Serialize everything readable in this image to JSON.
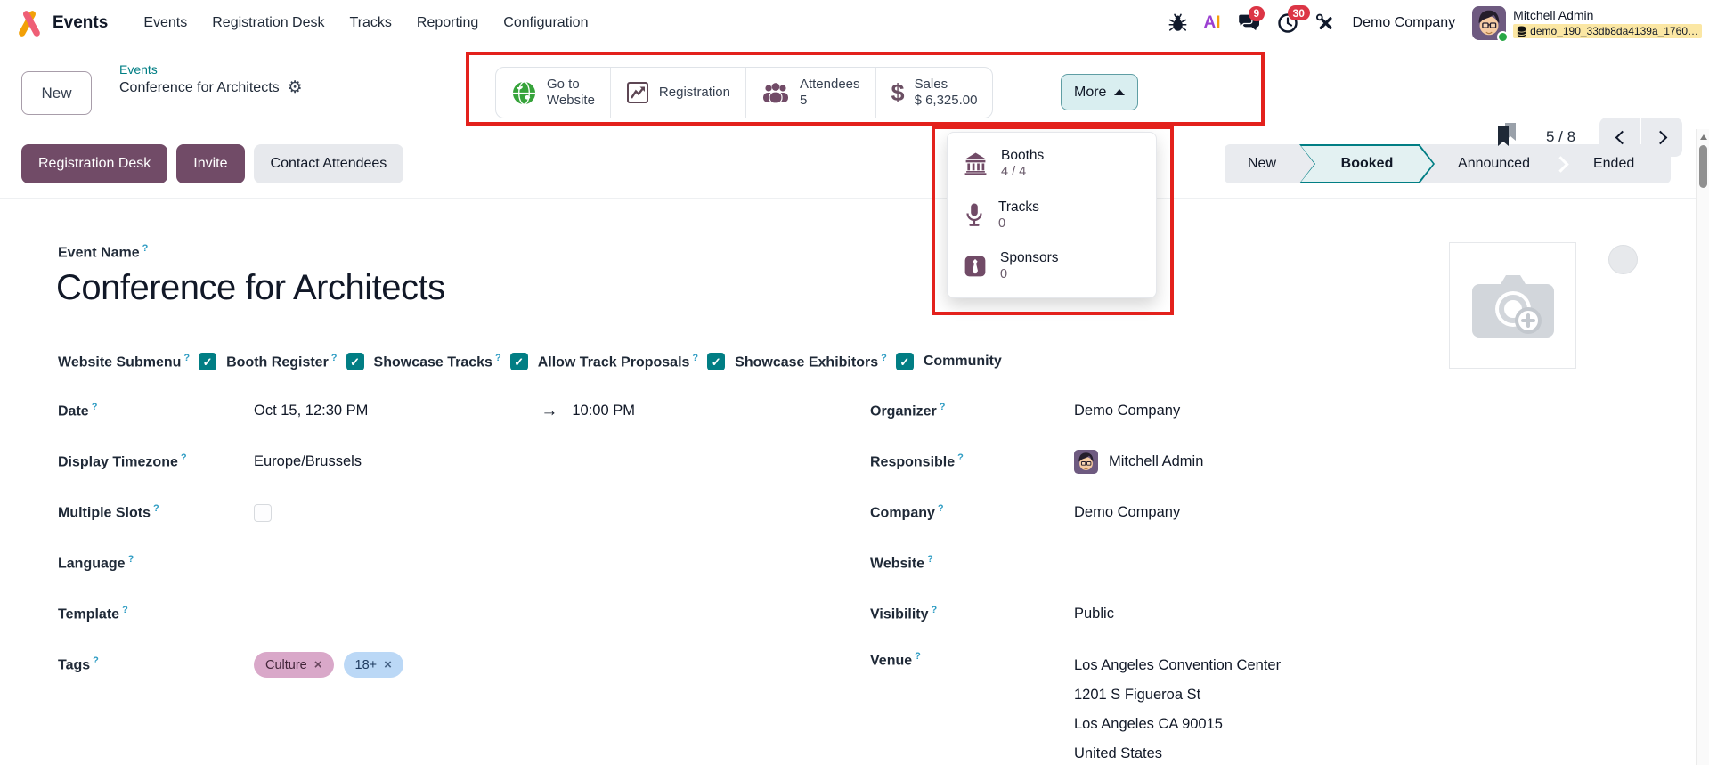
{
  "colors": {
    "primary": "#714B67",
    "accent_teal": "#017E84",
    "annotation_red": "#E3211C",
    "badge_red": "#DC3545",
    "tag_culture_bg": "#D9A8C9",
    "tag_18plus_bg": "#BBD8F6"
  },
  "nav": {
    "app_name": "Events",
    "menus": [
      "Events",
      "Registration Desk",
      "Tracks",
      "Reporting",
      "Configuration"
    ],
    "systray": {
      "messages_badge": "9",
      "activities_badge": "30",
      "ai_a": "A",
      "ai_i": "I",
      "company": "Demo Company",
      "user_name": "Mitchell Admin",
      "database": "demo_190_33db8da4139a_1760…"
    }
  },
  "control_panel": {
    "new_button": "New",
    "breadcrumb_parent": "Events",
    "record_title": "Conference for Architects",
    "pager": "5 / 8"
  },
  "smart_buttons": {
    "go_to_website": {
      "line1": "Go to",
      "line2": "Website",
      "icon": "globe-icon"
    },
    "registration": {
      "line1": "Registration",
      "icon": "chart-icon"
    },
    "attendees": {
      "line1": "Attendees",
      "line2": "5",
      "icon": "users-icon"
    },
    "sales": {
      "line1": "Sales",
      "line2": "$ 6,325.00",
      "icon": "dollar-icon"
    },
    "more_label": "More"
  },
  "more_menu": {
    "items": [
      {
        "label": "Booths",
        "count": "4 / 4",
        "icon": "bank-icon"
      },
      {
        "label": "Tracks",
        "count": "0",
        "icon": "microphone-icon"
      },
      {
        "label": "Sponsors",
        "count": "0",
        "icon": "tie-icon"
      }
    ]
  },
  "actions": {
    "registration_desk": "Registration Desk",
    "invite": "Invite",
    "contact_attendees": "Contact Attendees"
  },
  "stages": {
    "items": [
      "New",
      "Booked",
      "Announced",
      "Ended"
    ],
    "active": "Booked"
  },
  "form": {
    "event_name_label": "Event Name",
    "event_name_help": "?",
    "event_name": "Conference for Architects",
    "options": [
      {
        "label": "Website Submenu",
        "help": "?",
        "checked": true
      },
      {
        "label": "Booth Register",
        "help": "?",
        "checked": true
      },
      {
        "label": "Showcase Tracks",
        "help": "?",
        "checked": true
      },
      {
        "label": "Allow Track Proposals",
        "help": "?",
        "checked": true
      },
      {
        "label": "Showcase Exhibitors",
        "help": "?",
        "checked": true
      },
      {
        "label": "Community",
        "help": "",
        "checked": false
      }
    ],
    "left": [
      {
        "label": "Date",
        "help": "?",
        "start": "Oct 15, 12:30 PM",
        "end": "10:00 PM"
      },
      {
        "label": "Display Timezone",
        "help": "?",
        "value": "Europe/Brussels"
      },
      {
        "label": "Multiple Slots",
        "help": "?",
        "value": ""
      },
      {
        "label": "Language",
        "help": "?",
        "value": ""
      },
      {
        "label": "Template",
        "help": "?",
        "value": ""
      },
      {
        "label": "Tags",
        "help": "?"
      }
    ],
    "tags": [
      {
        "text": "Culture",
        "remove": "×",
        "bg": "#D9A8C9"
      },
      {
        "text": "18+",
        "remove": "×",
        "bg": "#BBD8F6"
      }
    ],
    "right": [
      {
        "label": "Organizer",
        "help": "?",
        "value": "Demo Company"
      },
      {
        "label": "Responsible",
        "help": "?",
        "value": "Mitchell Admin"
      },
      {
        "label": "Company",
        "help": "?",
        "value": "Demo Company"
      },
      {
        "label": "Website",
        "help": "?",
        "value": ""
      },
      {
        "label": "Visibility",
        "help": "?",
        "value": "Public"
      },
      {
        "label": "Venue",
        "help": "?",
        "lines": [
          "Los Angeles Convention Center",
          "1201 S Figueroa St",
          "Los Angeles CA 90015",
          "United States"
        ]
      }
    ]
  }
}
